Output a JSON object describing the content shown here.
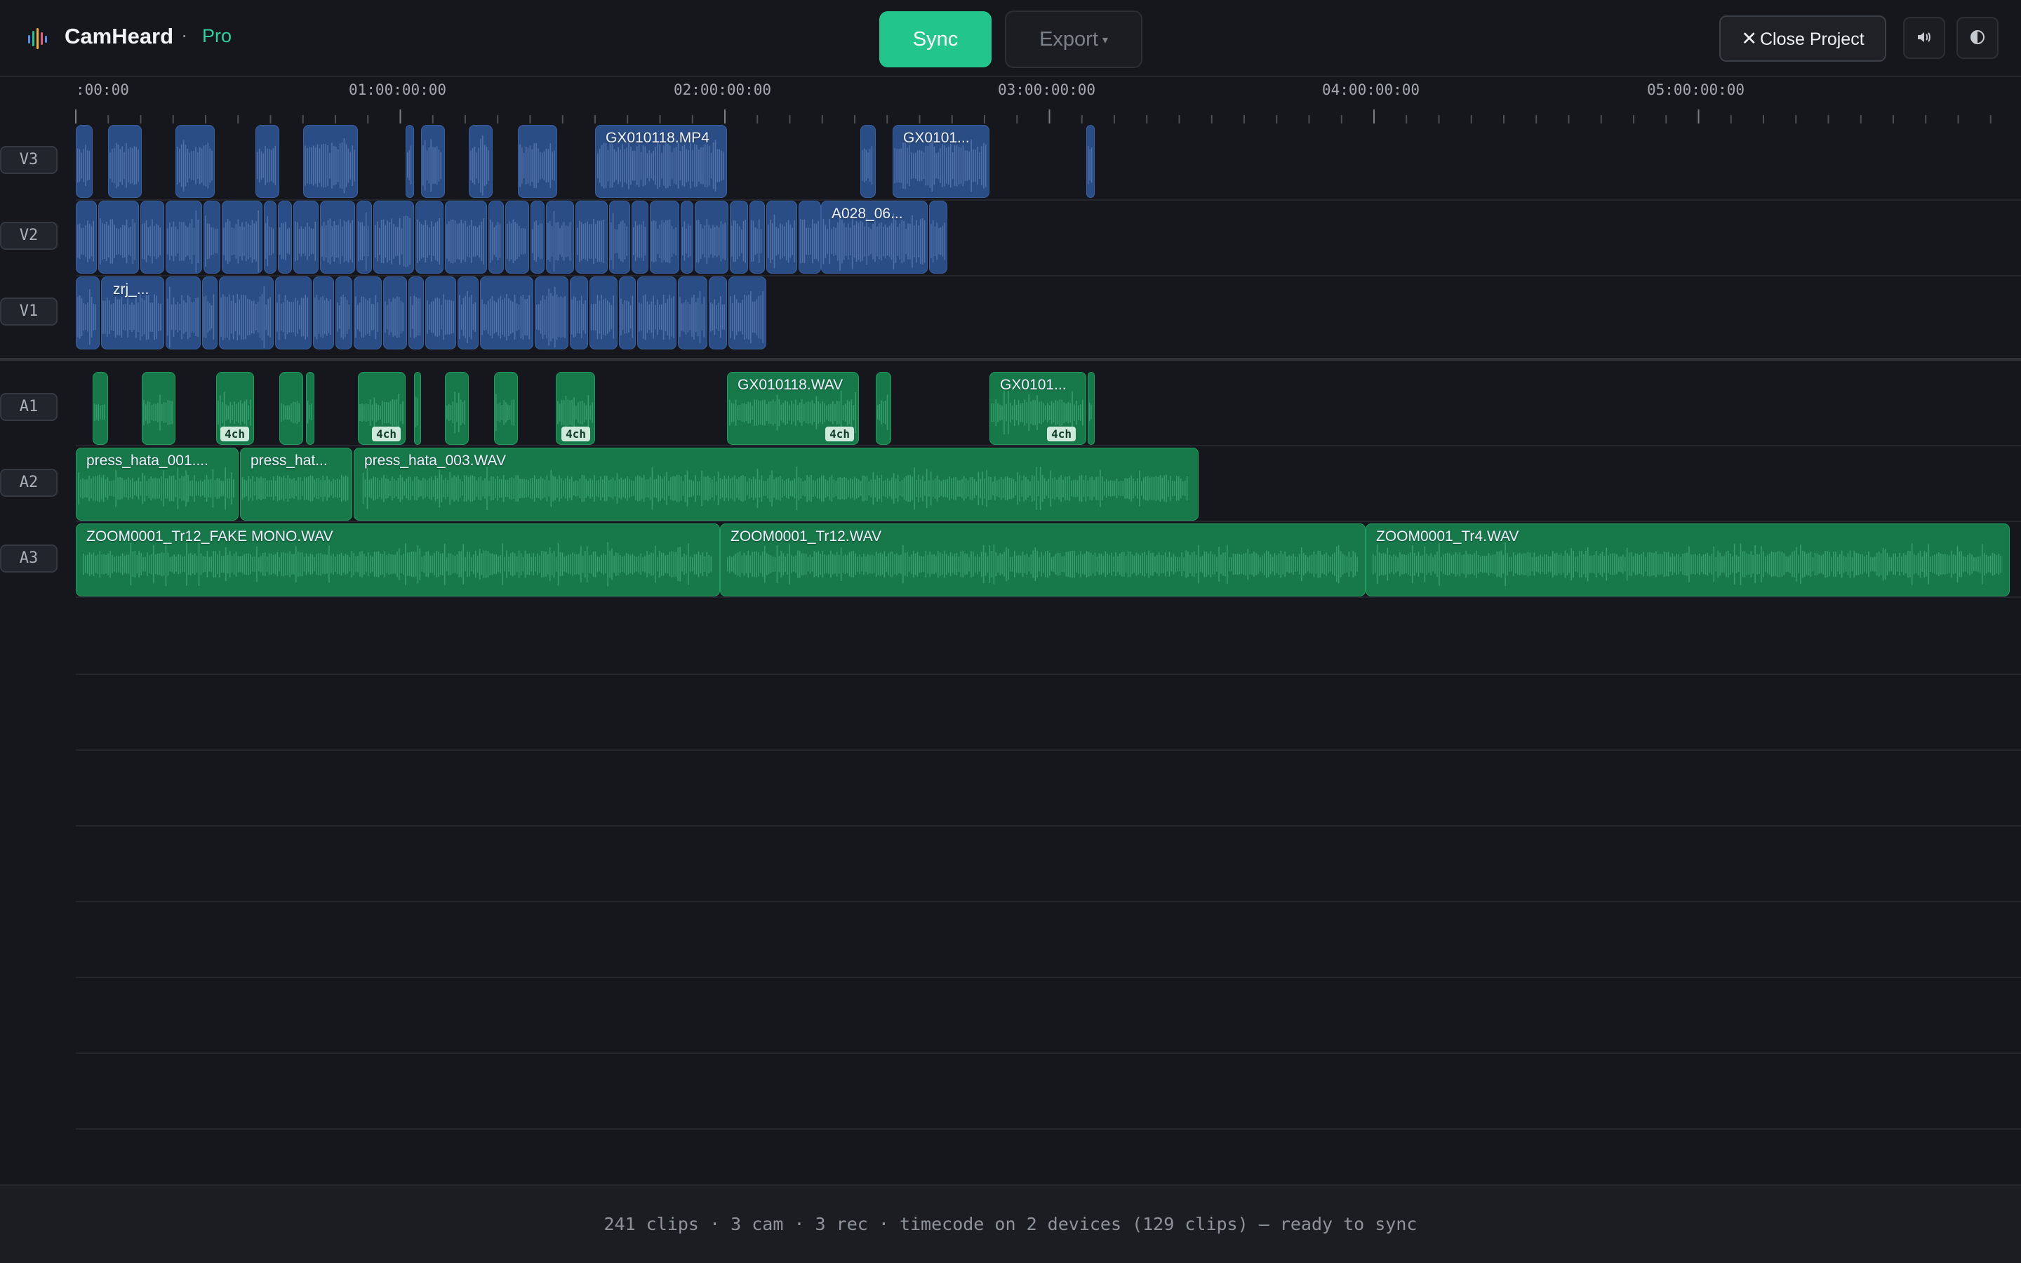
{
  "header": {
    "app_name": "CamHeard",
    "separator": "·",
    "tier": "Pro",
    "sync_label": "Sync",
    "export_label": "Export",
    "close_label": "Close Project",
    "icons": [
      "logo-icon",
      "volume-icon",
      "theme-toggle-icon"
    ]
  },
  "ruler": {
    "labels": [
      ":00:00",
      "01:00:00:00",
      "02:00:00:00",
      "03:00:00:00",
      "04:00:00:00",
      "05:00:00:00"
    ]
  },
  "tracks": {
    "video": [
      "V3",
      "V2",
      "V1"
    ],
    "audio": [
      "A1",
      "A2",
      "A3"
    ]
  },
  "clip_names": {
    "v3_main": "GX010118.MP4",
    "v3_second": "GX0101...",
    "v2_main": "A028_06...",
    "v1_main": "zrj_...",
    "a1_main": "GX010118.WAV",
    "a1_second": "GX0101...",
    "a2_first": "press_hata_001....",
    "a2_second": "press_hat...",
    "a2_third": "press_hata_003.WAV",
    "a3_first": "ZOOM0001_Tr12_FAKE MONO.WAV",
    "a3_second": "ZOOM0001_Tr12.WAV",
    "a3_third": "ZOOM0001_Tr4.WAV"
  },
  "channel_badge": "4ch",
  "colors": {
    "accent": "#22c58b",
    "video_clip": "#2a4d86",
    "audio_clip": "#17794a",
    "background": "#15171c"
  },
  "status": "241 clips · 3 cam · 3 rec · timecode on 2 devices (129 clips) — ready to sync"
}
